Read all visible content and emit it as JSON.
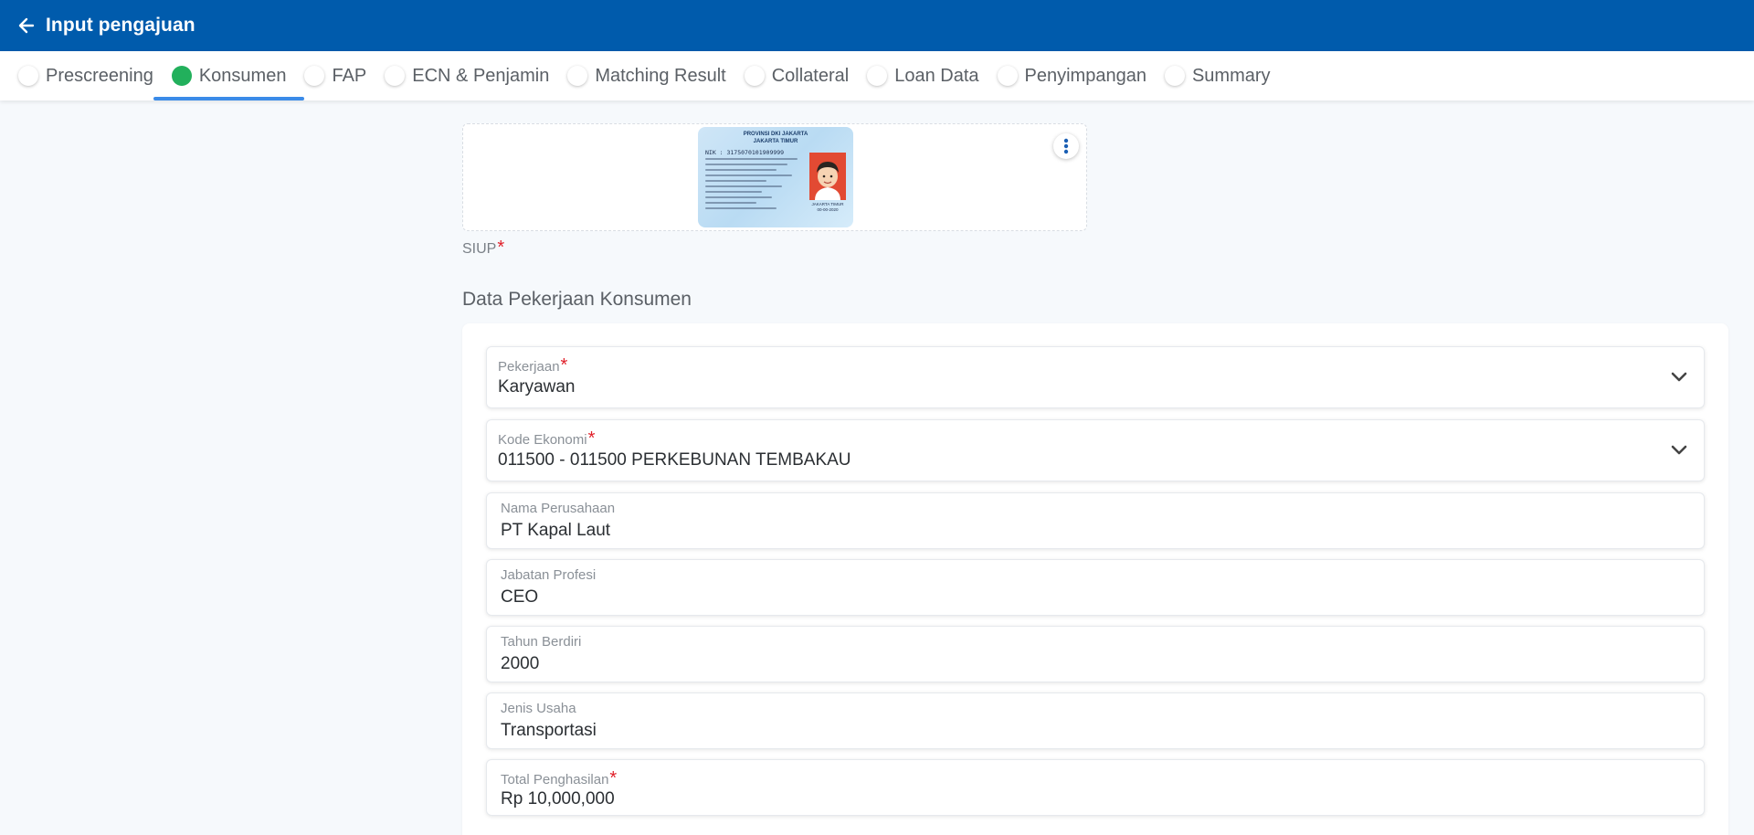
{
  "header": {
    "title": "Input pengajuan"
  },
  "tabs": [
    {
      "label": "Prescreening",
      "active": false
    },
    {
      "label": "Konsumen",
      "active": true
    },
    {
      "label": "FAP",
      "active": false
    },
    {
      "label": "ECN & Penjamin",
      "active": false
    },
    {
      "label": "Matching Result",
      "active": false
    },
    {
      "label": "Collateral",
      "active": false
    },
    {
      "label": "Loan Data",
      "active": false
    },
    {
      "label": "Penyimpangan",
      "active": false
    },
    {
      "label": "Summary",
      "active": false
    }
  ],
  "document": {
    "label": "SIUP",
    "required_mark": "*",
    "card_header_line1": "PROVINSI DKI JAKARTA",
    "card_header_line2": "JAKARTA TIMUR",
    "card_nik": "NIK : 3175070101909999",
    "card_footer_line1": "JAKARTA TIMUR",
    "card_footer_line2": "00-00-2020"
  },
  "section": {
    "title": "Data Pekerjaan Konsumen"
  },
  "form": {
    "pekerjaan": {
      "label": "Pekerjaan",
      "value": "Karyawan"
    },
    "kode_ekonomi": {
      "label": "Kode Ekonomi",
      "value": "011500 - 011500 PERKEBUNAN TEMBAKAU"
    },
    "nama_perusahaan": {
      "label": "Nama Perusahaan",
      "value": "PT Kapal Laut"
    },
    "jabatan_profesi": {
      "label": "Jabatan Profesi",
      "value": "CEO"
    },
    "tahun_berdiri": {
      "label": "Tahun Berdiri",
      "value": "2000"
    },
    "jenis_usaha": {
      "label": "Jenis Usaha",
      "value": "Transportasi"
    },
    "total_penghasilan": {
      "label": "Total Penghasilan",
      "value": "Rp 10,000,000"
    },
    "required_mark": "*"
  },
  "colors": {
    "header_bg": "#005bac",
    "active_dot": "#22b05c",
    "tab_underline": "#3b8be8",
    "required": "#e0202a",
    "kebab": "#1a5fb4"
  }
}
